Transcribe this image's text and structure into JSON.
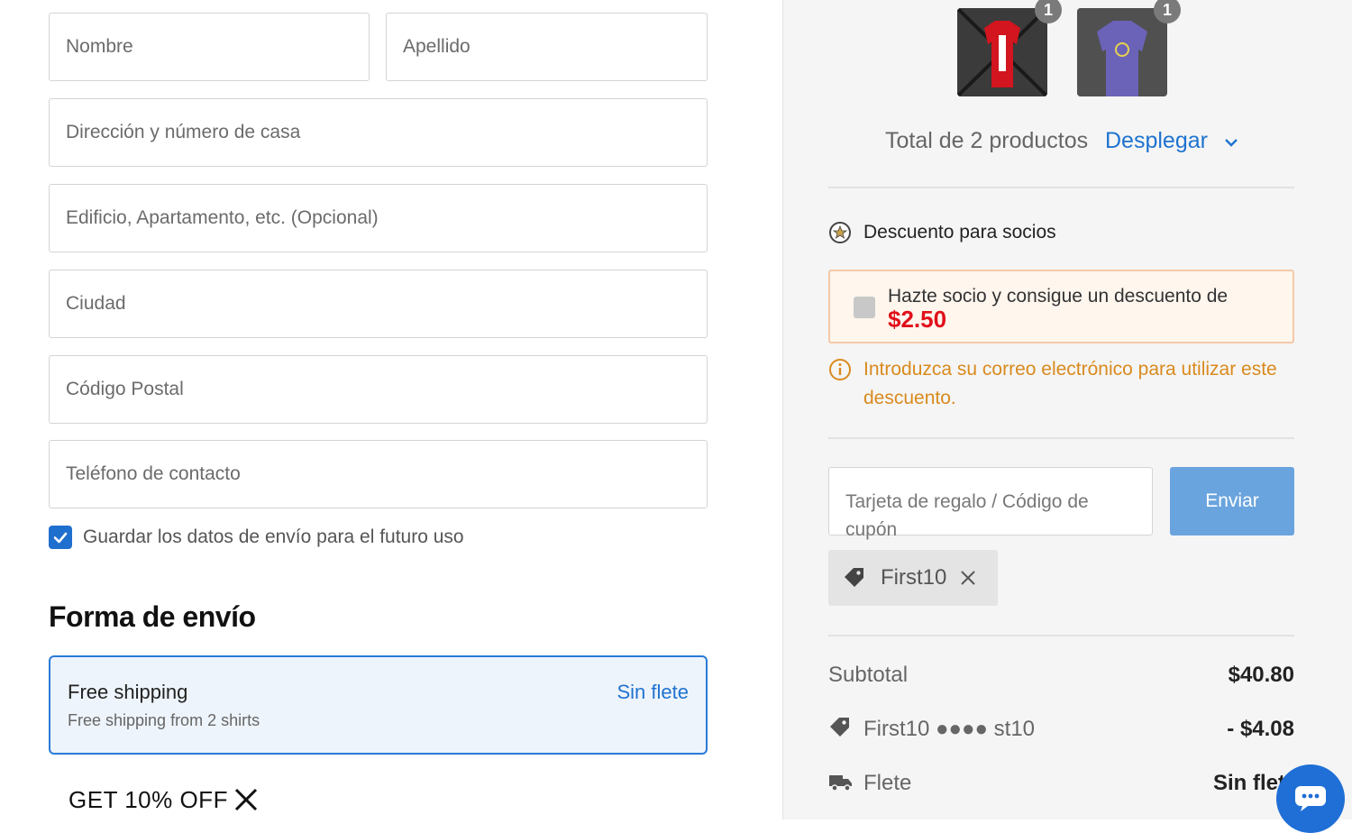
{
  "form": {
    "first_name_placeholder": "Nombre",
    "last_name_placeholder": "Apellido",
    "address_placeholder": "Dirección y número de casa",
    "address2_placeholder": "Edificio, Apartamento, etc. (Opcional)",
    "city_placeholder": "Ciudad",
    "postal_placeholder": "Código Postal",
    "phone_placeholder": "Teléfono de contacto",
    "save_label": "Guardar los datos de envío para el futuro uso",
    "save_checked": true
  },
  "shipping": {
    "title": "Forma de envío",
    "option_name": "Free shipping",
    "option_desc": "Free shipping from 2 shirts",
    "option_price": "Sin flete"
  },
  "promo": {
    "text": "GET 10% OFF"
  },
  "cart": {
    "items": [
      {
        "qty": "1",
        "color": "#d2151e"
      },
      {
        "qty": "1",
        "color": "#6a63b8"
      }
    ],
    "total_label": "Total de 2 productos",
    "expand_label": "Desplegar"
  },
  "member": {
    "title": "Descuento para socios",
    "offer_text": "Hazte socio y consigue un descuento de",
    "offer_amount": "$2.50",
    "warning": "Introduzca su correo electrónico para utilizar este descuento."
  },
  "coupon": {
    "placeholder": "Tarjeta de regalo / Código de cupón",
    "submit_label": "Enviar",
    "applied_code": "First10"
  },
  "summary": {
    "subtotal_label": "Subtotal",
    "subtotal_value": "$40.80",
    "discount_label": "First10 ●●●● st10",
    "discount_value": "- $4.08",
    "shipping_label": "Flete",
    "shipping_value": "Sin flete"
  },
  "colors": {
    "accent": "#1f73d0",
    "discount_red": "#e0101a",
    "warning_orange": "#d98a1e"
  }
}
